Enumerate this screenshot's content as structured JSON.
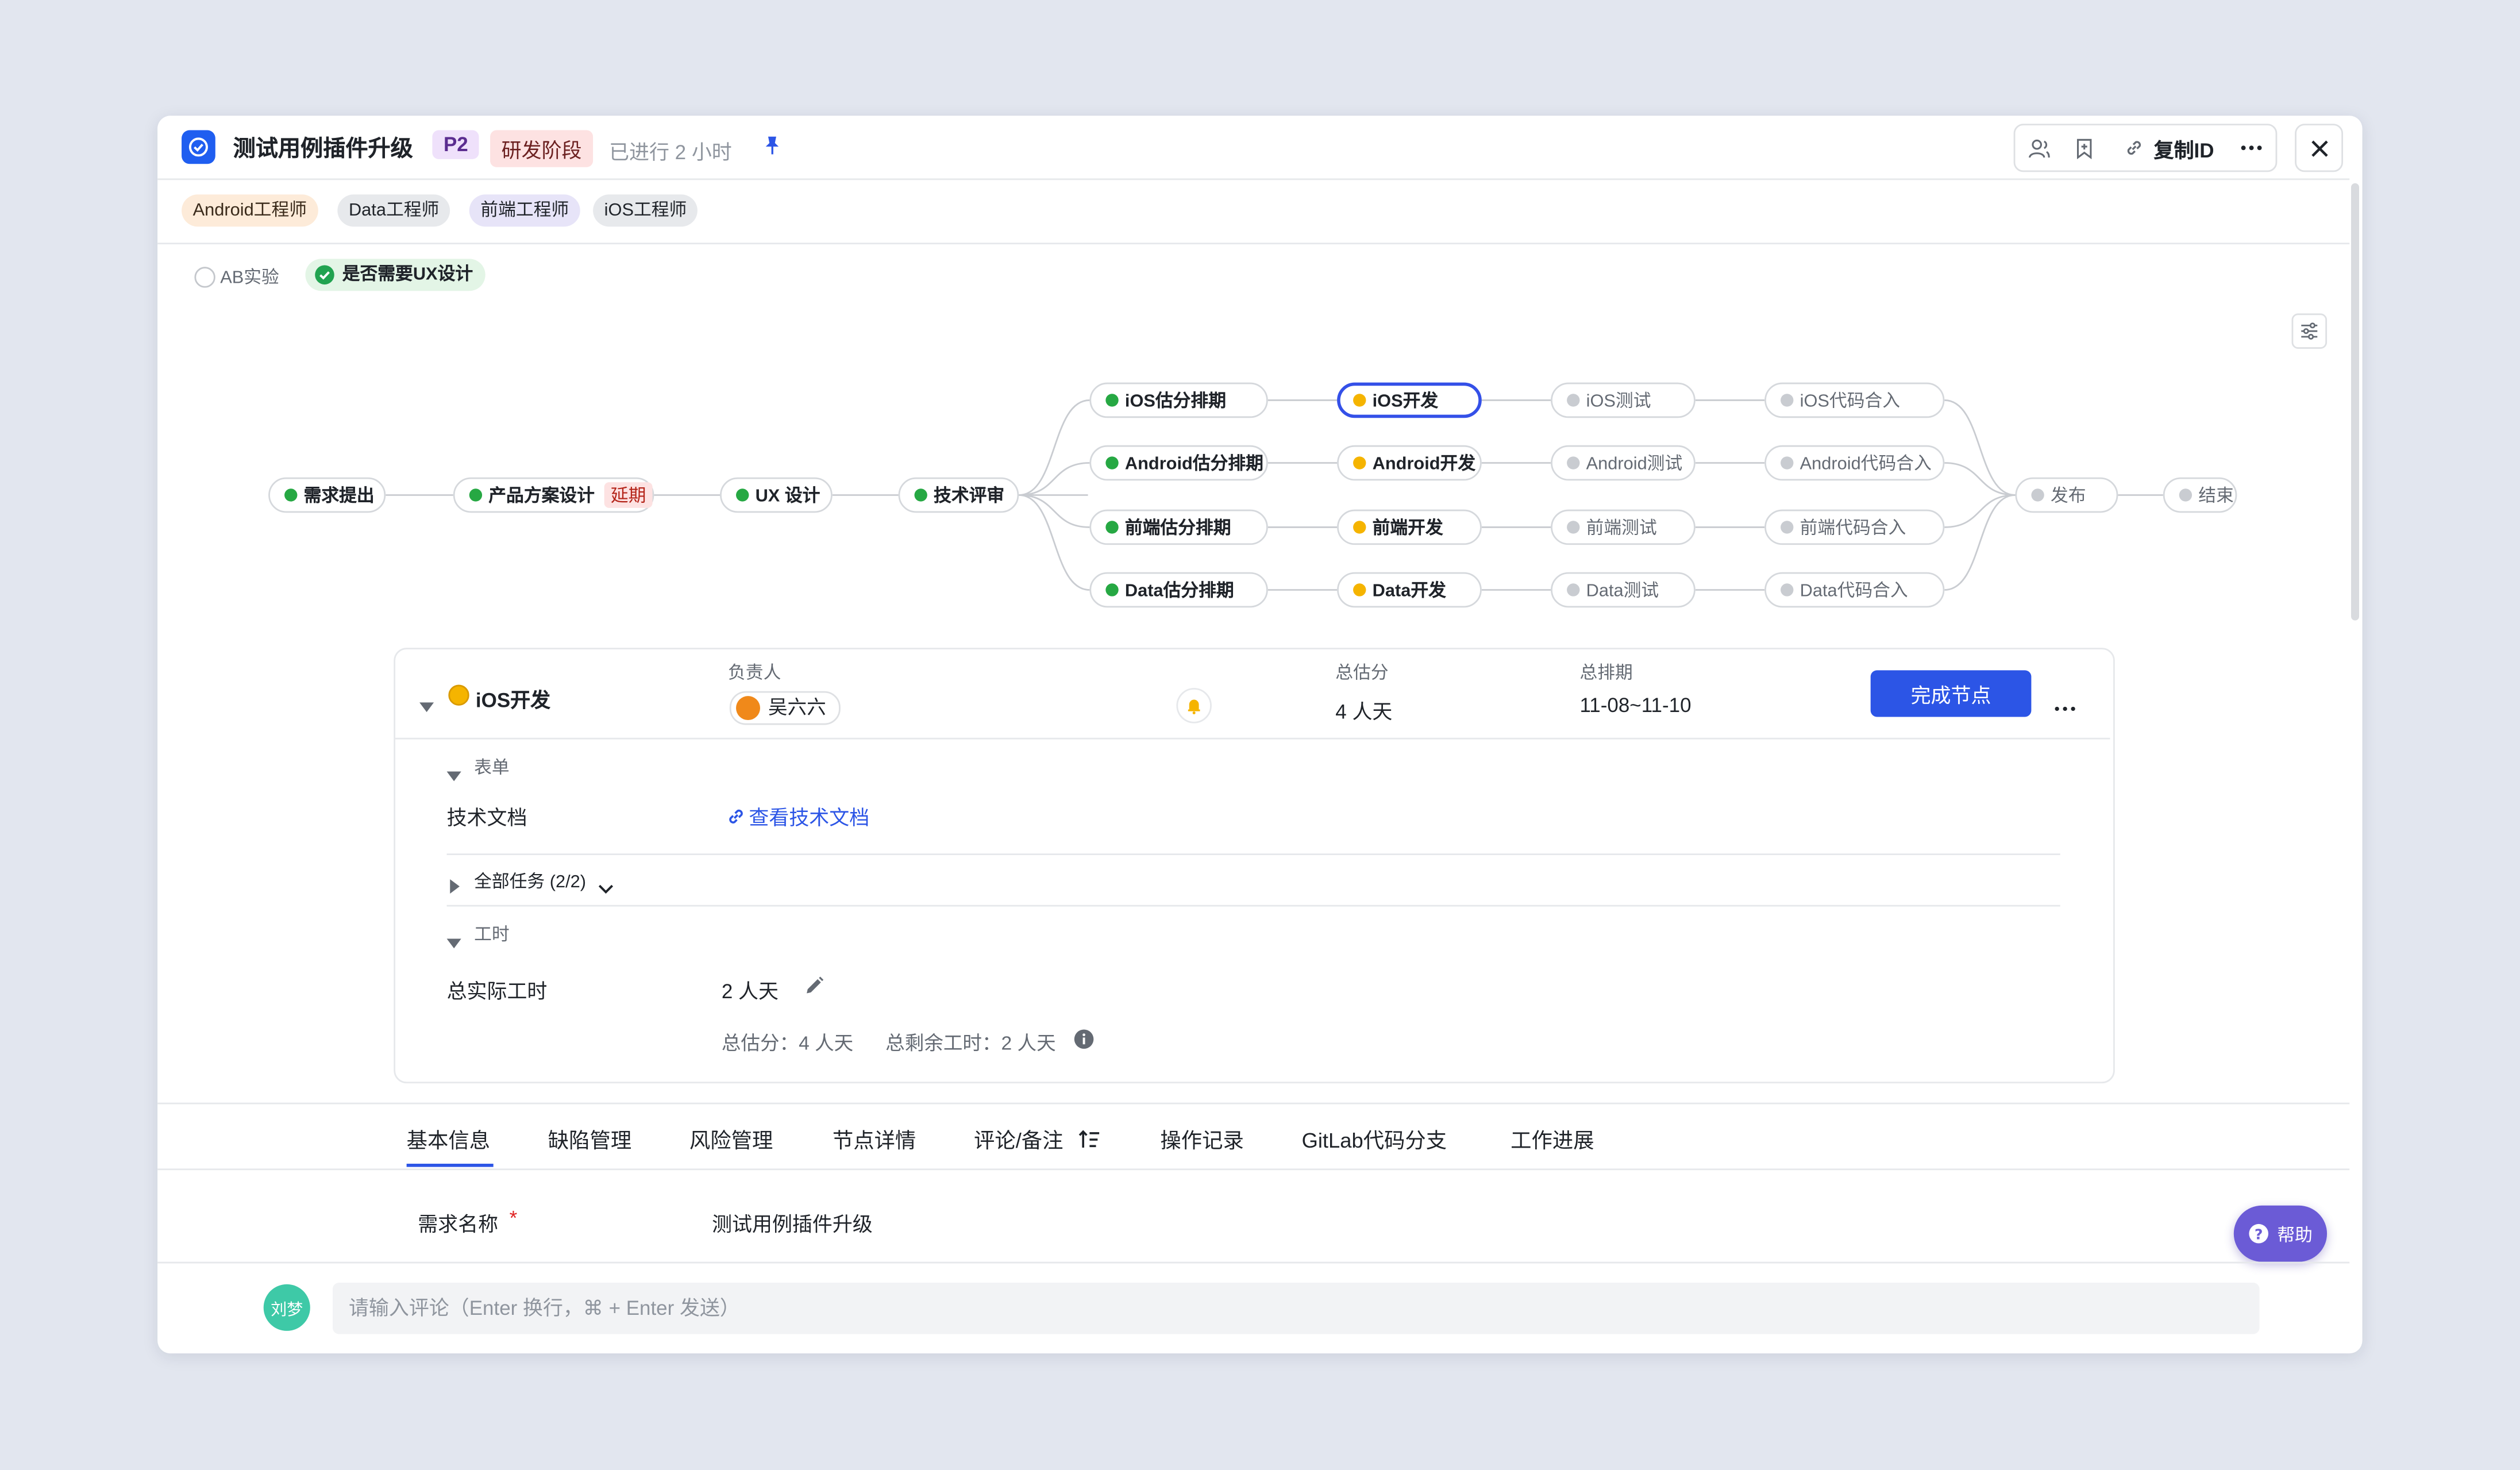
{
  "header": {
    "title": "测试用例插件升级",
    "priority": "P2",
    "stage": "研发阶段",
    "elapsed": "已进行 2 小时",
    "copy_id_label": "复制ID"
  },
  "tags": [
    "Android工程师",
    "Data工程师",
    "前端工程师",
    "iOS工程师"
  ],
  "options": {
    "ab_label": "AB实验",
    "ux_label": "是否需要UX设计"
  },
  "flow": {
    "n_req": "需求提出",
    "n_product": "产品方案设计",
    "n_delay": "延期",
    "n_ux": "UX 设计",
    "n_tech": "技术评审",
    "n_ios_est": "iOS估分排期",
    "n_and_est": "Android估分排期",
    "n_fe_est": "前端估分排期",
    "n_data_est": "Data估分排期",
    "n_ios_dev": "iOS开发",
    "n_and_dev": "Android开发",
    "n_fe_dev": "前端开发",
    "n_data_dev": "Data开发",
    "n_ios_test": "iOS测试",
    "n_and_test": "Android测试",
    "n_fe_test": "前端测试",
    "n_data_test": "Data测试",
    "n_ios_merge": "iOS代码合入",
    "n_and_merge": "Android代码合入",
    "n_fe_merge": "前端代码合入",
    "n_data_merge": "Data代码合入",
    "n_release": "发布",
    "n_end": "结束"
  },
  "detail": {
    "node_name": "iOS开发",
    "owner_label": "负责人",
    "owner_name": "吴六六",
    "estimate_label": "总估分",
    "estimate_value": "4 人天",
    "schedule_label": "总排期",
    "schedule_value": "11-08~11-10",
    "complete_button": "完成节点",
    "form_section": "表单",
    "tech_doc_label": "技术文档",
    "tech_doc_link": "查看技术文档",
    "tasks_section": "全部任务 (2/2)",
    "hours_section": "工时",
    "actual_label": "总实际工时",
    "actual_value": "2 人天",
    "summary_estimate": "总估分：4 人天",
    "summary_remaining": "总剩余工时：2 人天"
  },
  "tabs": [
    "基本信息",
    "缺陷管理",
    "风险管理",
    "节点详情",
    "评论/备注",
    "操作记录",
    "GitLab代码分支",
    "工作进展"
  ],
  "basic": {
    "name_label": "需求名称",
    "required_mark": "*",
    "name_value": "测试用例插件升级"
  },
  "help_label": "帮助",
  "comment": {
    "user": "刘梦",
    "placeholder": "请输入评论（Enter 换行，⌘ + Enter 发送）"
  },
  "colors": {
    "accent": "#2c55e6",
    "done": "#26a843",
    "doing": "#f5b400",
    "todo": "#c9ccd1",
    "priority_bg": "#efe1fb",
    "stage_bg": "#fde2e2",
    "help_bg": "#6b5bd6"
  }
}
